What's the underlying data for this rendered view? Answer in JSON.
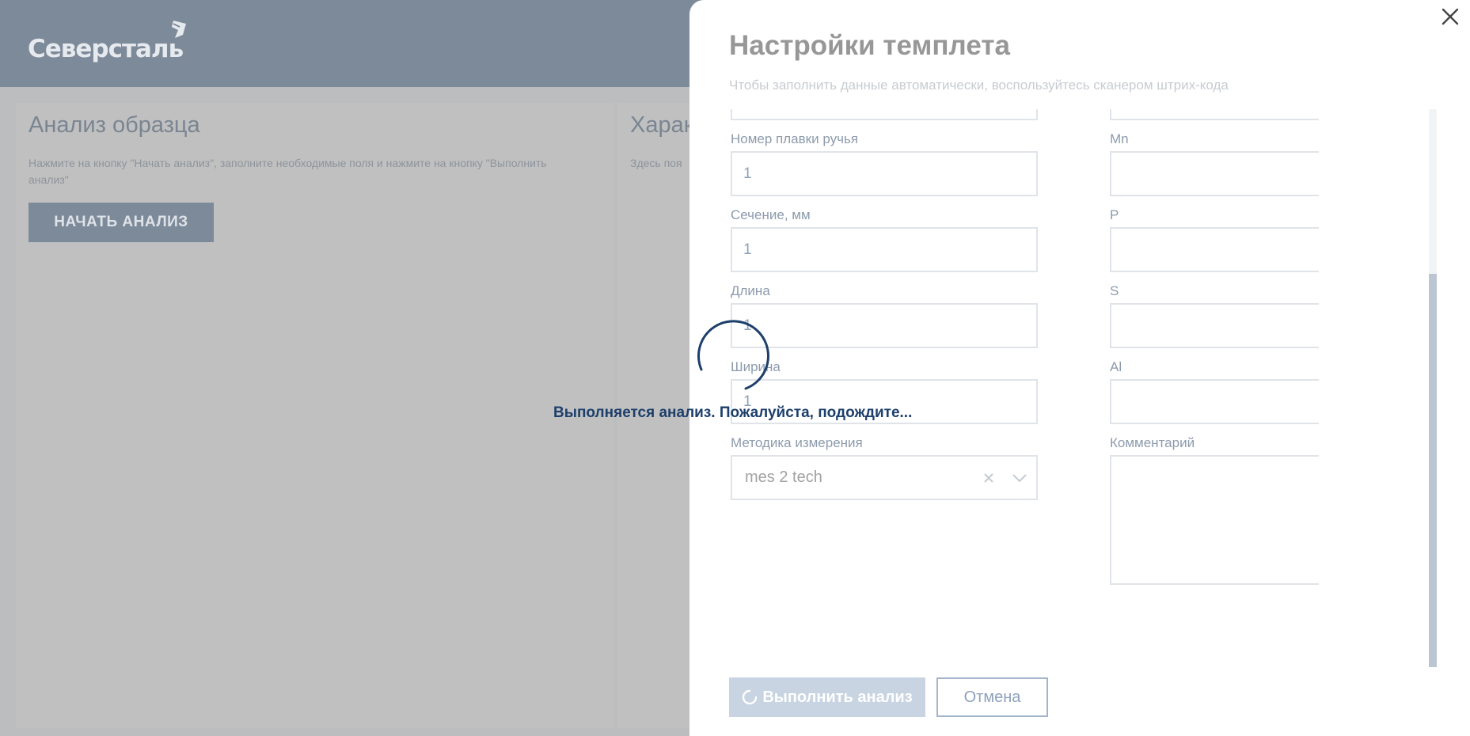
{
  "header": {
    "logo_text": "Северсталь"
  },
  "left_card": {
    "title": "Анализ образца",
    "description": "Нажмите на кнопку \"Начать анализ\", заполните необходимые поля и нажмите на кнопку \"Выполнить анализ\"",
    "start_button": "НАЧАТЬ АНАЛИЗ"
  },
  "right_card": {
    "title": "Харак",
    "description": "Здесь поя"
  },
  "modal": {
    "title": "Настройки темплета",
    "subtitle": "Чтобы заполнить данные автоматически, воспользуйтесь сканером штрих-кода",
    "left_fields": [
      {
        "label": "Номер плавки ручья",
        "value": "1"
      },
      {
        "label": "Сечение, мм",
        "value": "1"
      },
      {
        "label": "Длина",
        "value": "1"
      },
      {
        "label": "Ширина",
        "value": "1"
      }
    ],
    "method": {
      "label": "Методика измерения",
      "value": "mes 2 tech"
    },
    "right_fields": [
      {
        "label": "Mn",
        "value": ""
      },
      {
        "label": "P",
        "value": ""
      },
      {
        "label": "S",
        "value": ""
      },
      {
        "label": "Al",
        "value": ""
      }
    ],
    "comment": {
      "label": "Комментарий",
      "value": ""
    },
    "run_button": "Выполнить анализ",
    "cancel_button": "Отмена"
  },
  "loading": {
    "text": "Выполняется анализ. Пожалуйста, подождите..."
  },
  "colors": {
    "header_bg": "#7d8a9a",
    "page_bg": "#bcbdbe",
    "accent": "#1d3f6b",
    "input_text": "#6d86a4"
  }
}
